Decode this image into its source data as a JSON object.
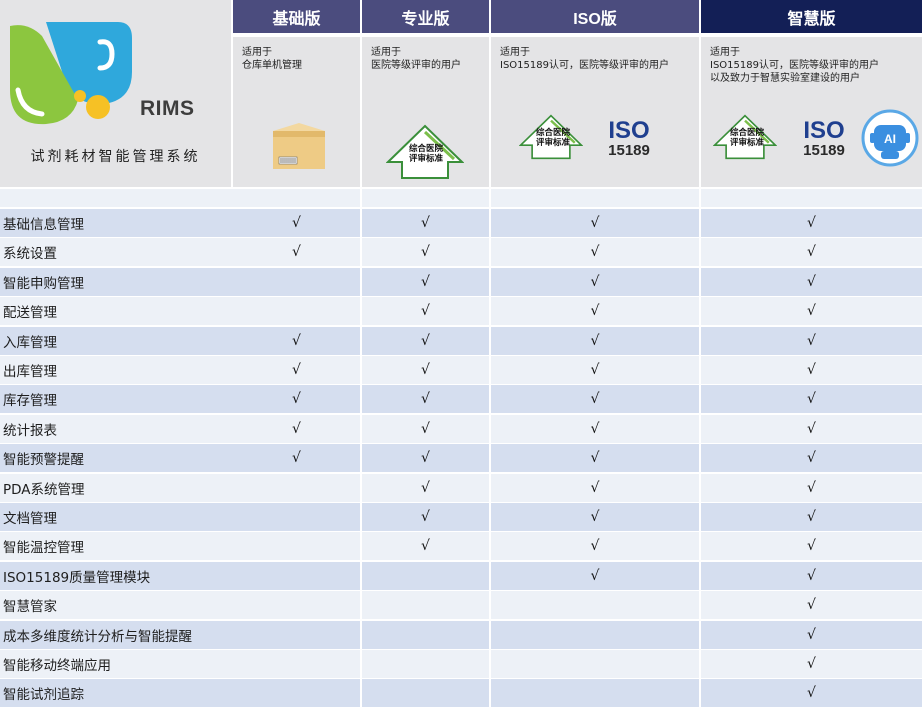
{
  "logo": {
    "brand": "RIMS",
    "subtitle": "试剂耗材智能管理系统"
  },
  "columns": [
    {
      "id": "basic",
      "title": "基础版",
      "desc": [
        "适用于",
        "仓库单机管理"
      ]
    },
    {
      "id": "pro",
      "title": "专业版",
      "desc": [
        "适用于",
        "医院等级评审的用户"
      ]
    },
    {
      "id": "iso",
      "title": "ISO版",
      "desc": [
        "适用于",
        "ISO15189认可，医院等级评审的用户"
      ]
    },
    {
      "id": "smart",
      "title": "智慧版",
      "desc": [
        "适用于",
        "ISO15189认可，医院等级评审的用户",
        "以及致力于智慧实验室建设的用户"
      ]
    }
  ],
  "icon_text": {
    "pyramid_line1": "综合医院",
    "pyramid_line2": "评审标准",
    "iso_top": "ISO",
    "iso_bottom": "15189",
    "ai": "AI"
  },
  "check": "√",
  "rows": [
    {
      "label": "基础信息管理",
      "marks": [
        true,
        true,
        true,
        true
      ]
    },
    {
      "label": "系统设置",
      "marks": [
        true,
        true,
        true,
        true
      ]
    },
    {
      "label": "智能申购管理",
      "marks": [
        false,
        true,
        true,
        true
      ]
    },
    {
      "label": "配送管理",
      "marks": [
        false,
        true,
        true,
        true
      ]
    },
    {
      "label": "入库管理",
      "marks": [
        true,
        true,
        true,
        true
      ]
    },
    {
      "label": "出库管理",
      "marks": [
        true,
        true,
        true,
        true
      ]
    },
    {
      "label": "库存管理",
      "marks": [
        true,
        true,
        true,
        true
      ]
    },
    {
      "label": "统计报表",
      "marks": [
        true,
        true,
        true,
        true
      ]
    },
    {
      "label": "智能预警提醒",
      "marks": [
        true,
        true,
        true,
        true
      ]
    },
    {
      "label": "PDA系统管理",
      "marks": [
        false,
        true,
        true,
        true
      ]
    },
    {
      "label": "文档管理",
      "marks": [
        false,
        true,
        true,
        true
      ]
    },
    {
      "label": "智能温控管理",
      "marks": [
        false,
        true,
        true,
        true
      ]
    },
    {
      "label": "ISO15189质量管理模块",
      "marks": [
        false,
        false,
        true,
        true
      ]
    },
    {
      "label": "智慧管家",
      "marks": [
        false,
        false,
        false,
        true
      ]
    },
    {
      "label": "成本多维度统计分析与智能提醒",
      "marks": [
        false,
        false,
        false,
        true
      ]
    },
    {
      "label": "智能移动终端应用",
      "marks": [
        false,
        false,
        false,
        true
      ]
    },
    {
      "label": "智能试剂追踪",
      "marks": [
        false,
        false,
        false,
        true
      ]
    }
  ]
}
